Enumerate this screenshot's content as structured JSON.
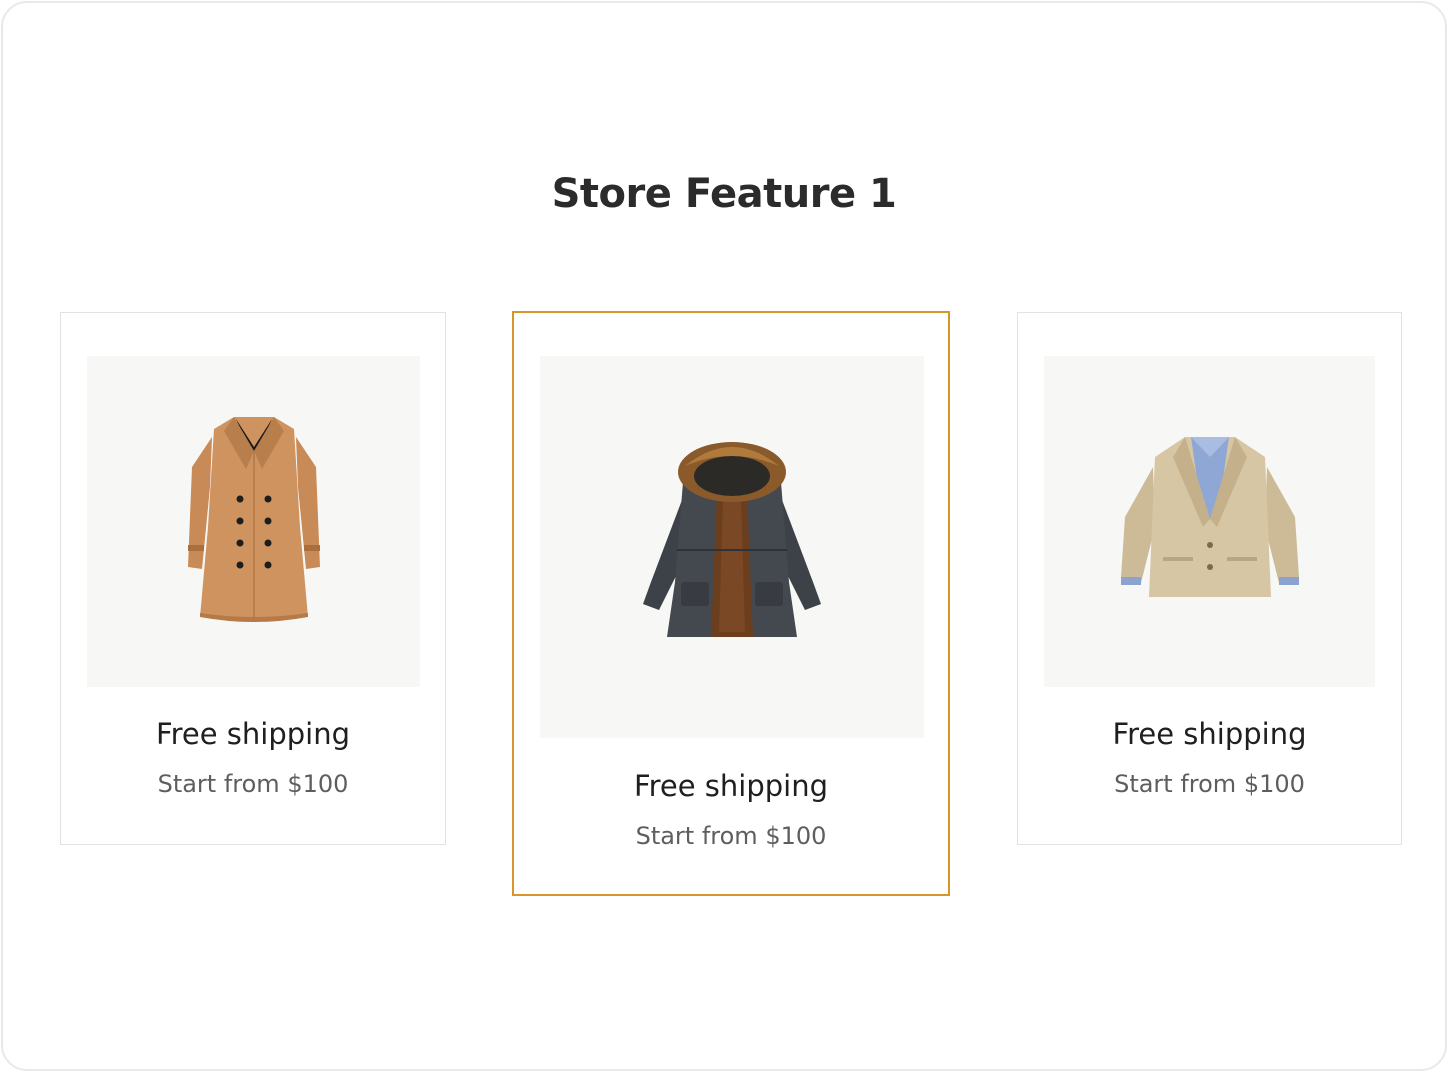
{
  "section": {
    "title": "Store Feature 1"
  },
  "cards": [
    {
      "image_icon": "camel-trench-coat-image",
      "label": "Free shipping",
      "sub": "Start from $100"
    },
    {
      "image_icon": "fur-hood-parka-image",
      "label": "Free shipping",
      "sub": "Start from $100",
      "highlighted": true
    },
    {
      "image_icon": "beige-blazer-image",
      "label": "Free shipping",
      "sub": "Start from $100"
    }
  ],
  "colors": {
    "highlight_border": "#d8952a",
    "card_border": "#e2e2e2",
    "image_background": "#f7f7f5",
    "title_text": "#2b2b2b"
  }
}
